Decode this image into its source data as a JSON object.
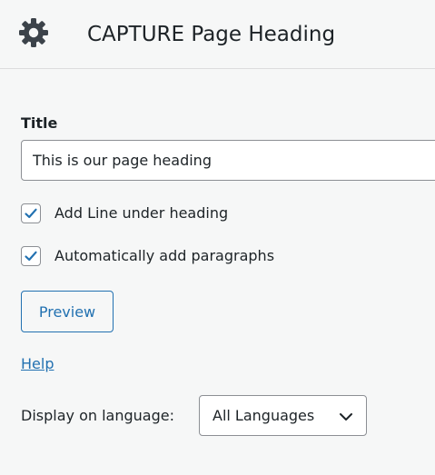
{
  "header": {
    "title": "CAPTURE Page Heading",
    "icon": "gear-icon"
  },
  "form": {
    "title_label": "Title",
    "title_value": "This is our page heading",
    "checkboxes": [
      {
        "label": "Add Line under heading",
        "checked": true
      },
      {
        "label": "Automatically add paragraphs",
        "checked": true
      }
    ],
    "preview_label": "Preview",
    "help_label": "Help",
    "language_label": "Display on language:",
    "language_selected": "All Languages"
  },
  "colors": {
    "accent": "#2271b1",
    "text": "#1d2327",
    "background": "#f6f7f7",
    "border": "#8c8f94"
  }
}
